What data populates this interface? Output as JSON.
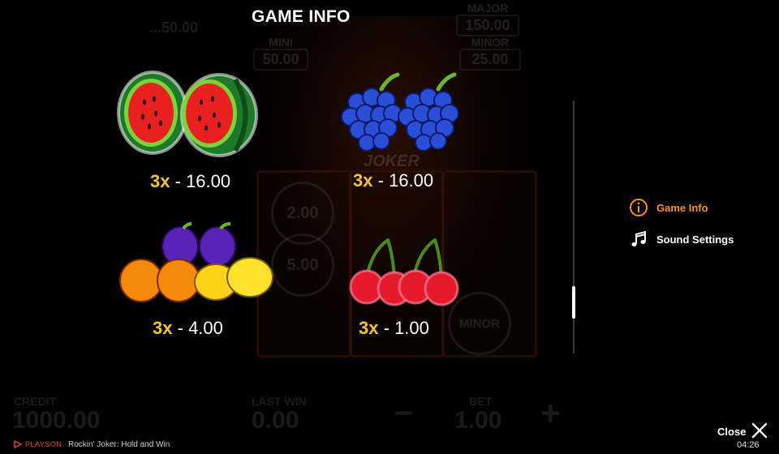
{
  "overlay": {
    "title": "GAME INFO"
  },
  "paytable": [
    {
      "symbol": "watermelon",
      "multiplier": "3x",
      "separator": "-",
      "value": "16.00"
    },
    {
      "symbol": "grapes",
      "multiplier": "3x",
      "separator": "-",
      "value": "16.00"
    },
    {
      "symbol": "orange-lemon-plum",
      "multiplier": "3x",
      "separator": "-",
      "value": "4.00"
    },
    {
      "symbol": "cherries",
      "multiplier": "3x",
      "separator": "-",
      "value": "1.00"
    }
  ],
  "menu": {
    "game_info": "Game Info",
    "sound_settings": "Sound Settings"
  },
  "close": {
    "label": "Close",
    "time": "04:26"
  },
  "footer": {
    "brand": "PLAYSON",
    "game_name": "Rockin' Joker: Hold and Win"
  },
  "background": {
    "jackpots": {
      "major_label": "MAJOR",
      "major_value": "150.00",
      "minor_label": "MINOR",
      "minor_value": "25.00",
      "mini_label": "MINI",
      "mini_value": "50.00",
      "grand_partial": "...50.00"
    },
    "reel_coins": [
      "2.00",
      "5.00"
    ],
    "reel_badge": "MINOR",
    "joker_label": "JOKER",
    "credit_label": "CREDIT",
    "credit_value": "1000.00",
    "last_win_label": "LAST WIN",
    "last_win_value": "0.00",
    "bet_label": "BET",
    "bet_value": "1.00",
    "minus": "−",
    "plus": "+"
  },
  "colors": {
    "accent": "#f7931e",
    "multiplier": "#f4c430",
    "background": "#000000"
  }
}
